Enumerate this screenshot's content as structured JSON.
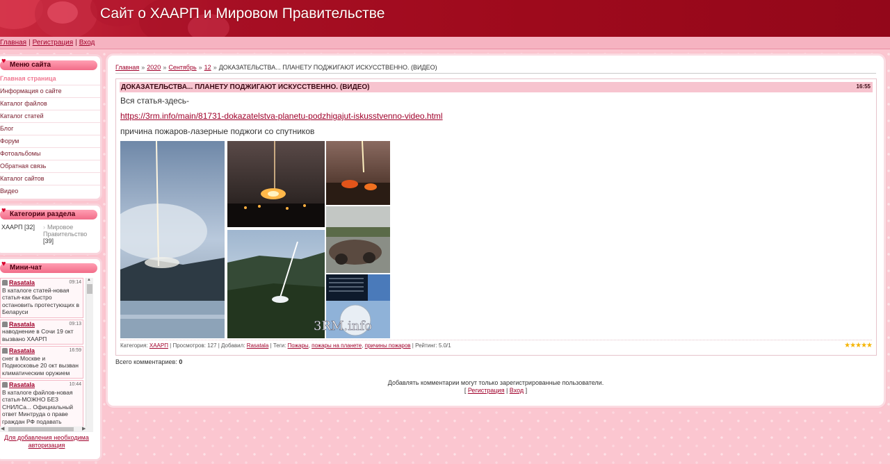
{
  "header": {
    "site_title": "Сайт о ХААРП и Мировом Правительстве"
  },
  "topnav": {
    "home": "Главная",
    "register": "Регистрация",
    "login": "Вход",
    "separator": "|"
  },
  "sidebar": {
    "menu_title": "Меню сайта",
    "menu_items": [
      {
        "label": "Главная страница",
        "active": true
      },
      {
        "label": "Информация о сайте"
      },
      {
        "label": "Каталог файлов"
      },
      {
        "label": "Каталог статей"
      },
      {
        "label": "Блог"
      },
      {
        "label": "Форум"
      },
      {
        "label": "Фотоальбомы"
      },
      {
        "label": "Обратная связь"
      },
      {
        "label": "Каталог сайтов"
      },
      {
        "label": "Видео"
      }
    ],
    "categories_title": "Категории раздела",
    "categories": [
      {
        "name": "ХААРП",
        "count": "[32]"
      },
      {
        "name": "Мировое Правительство",
        "count": "[39]"
      }
    ],
    "chat_title": "Мини-чат",
    "chat_messages": [
      {
        "user": "Rasatala",
        "time": "09:14",
        "text": "В каталоге статей-новая статья-как быстро остановить протестующих в Беларуси"
      },
      {
        "user": "Rasatala",
        "time": "09:13",
        "text": "наводнение в Сочи 19 окт вызвано ХААРП"
      },
      {
        "user": "Rasatala",
        "time": "16:59",
        "text": "снег в Москве и Подмосковье 20 окт вызван климатическим оружием"
      },
      {
        "user": "Rasatala",
        "time": "10:44",
        "text": "В каталоге файлов-новая статья-МОЖНО БЕЗ СНИЛСа... Официальный ответ Минтруда о праве граждан РФ подавать"
      }
    ],
    "chat_note": "Для добавления необходима авторизация"
  },
  "breadcrumb": {
    "items": [
      "Главная",
      "2020",
      "Сентябрь",
      "12"
    ],
    "current": "ДОКАЗАТЕЛЬСТВА... ПЛАНЕТУ ПОДЖИГАЮТ ИСКУССТВЕННО. (ВИДЕО)",
    "separator": "»"
  },
  "post": {
    "title": "ДОКАЗАТЕЛЬСТВА... ПЛАНЕТУ ПОДЖИГАЮТ ИСКУССТВЕННО. (ВИДЕО)",
    "time": "16:55",
    "intro": "Вся статья-здесь-",
    "link": "https://3rm.info/main/81731-dokazatelstva-planetu-podzhigajut-iskusstvenno-video.html",
    "subtitle": "причина пожаров-лазерные поджоги со спутников",
    "watermark": "3RM.info",
    "meta": {
      "category_label": "Категория:",
      "category": "ХААРП",
      "views": "Просмотров: 127",
      "added_label": "Добавил:",
      "author": "Rasatala",
      "tags_label": "Теги:",
      "tags": [
        "Пожары",
        "пожары на планете",
        "причины пожаров"
      ],
      "rating": "Рейтинг: 5.0/1"
    },
    "stars": "★★★★★"
  },
  "comments": {
    "total_label": "Всего комментариев:",
    "total": "0"
  },
  "login_note": {
    "text": "Добавлять комментарии могут только зарегистрированные пользователи.",
    "register": "Регистрация",
    "login": "Вход"
  },
  "colors": {
    "accent": "#a0002a",
    "header": "#9e0a1c",
    "pink": "#fbc6d0"
  }
}
